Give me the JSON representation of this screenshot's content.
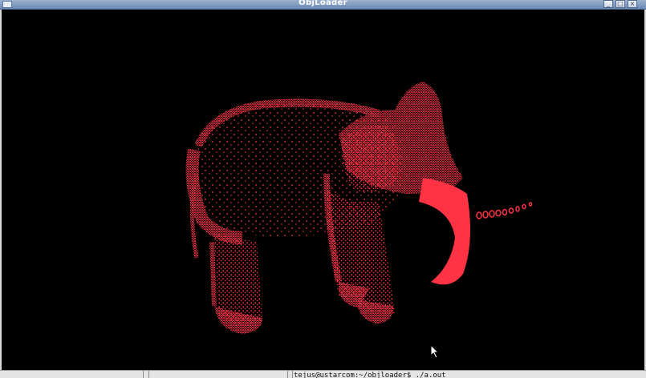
{
  "window": {
    "title": "ObjLoader",
    "controls": {
      "minimize": "_",
      "maximize": "□",
      "close": "×"
    }
  },
  "background_terminal": {
    "prompt_line": "tejus@ustarcom:~/objloader$ ./a.out"
  },
  "render": {
    "background_color": "#000000",
    "point_color": "#ff3344",
    "subject": "elephant point cloud"
  },
  "icons": [
    "window-app-icon",
    "minimize-icon",
    "maximize-icon",
    "close-icon",
    "mouse-cursor-icon"
  ]
}
